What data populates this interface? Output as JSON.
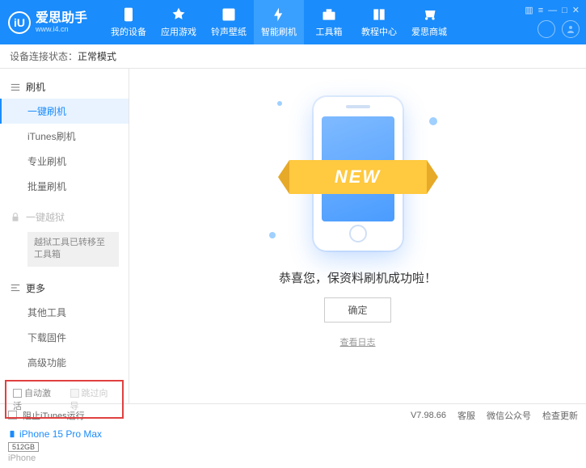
{
  "header": {
    "logo_mark": "iU",
    "app_name": "爱思助手",
    "url": "www.i4.cn",
    "nav": [
      {
        "label": "我的设备"
      },
      {
        "label": "应用游戏"
      },
      {
        "label": "铃声壁纸"
      },
      {
        "label": "智能刷机"
      },
      {
        "label": "工具箱"
      },
      {
        "label": "教程中心"
      },
      {
        "label": "爱思商城"
      }
    ]
  },
  "status": {
    "label": "设备连接状态：",
    "value": "正常模式"
  },
  "sidebar": {
    "flash": {
      "title": "刷机",
      "items": [
        "一键刷机",
        "iTunes刷机",
        "专业刷机",
        "批量刷机"
      ]
    },
    "jailbreak": {
      "title": "一键越狱",
      "note": "越狱工具已转移至工具箱"
    },
    "more": {
      "title": "更多",
      "items": [
        "其他工具",
        "下载固件",
        "高级功能"
      ]
    },
    "options": {
      "auto_activate": "自动激活",
      "skip_guide": "跳过向导"
    },
    "device": {
      "name": "iPhone 15 Pro Max",
      "capacity": "512GB",
      "type": "iPhone"
    }
  },
  "main": {
    "banner_text": "NEW",
    "success_message": "恭喜您，保资料刷机成功啦！",
    "confirm_button": "确定",
    "view_log": "查看日志"
  },
  "footer": {
    "block_itunes": "阻止iTunes运行",
    "version": "V7.98.66",
    "links": [
      "客服",
      "微信公众号",
      "检查更新"
    ]
  }
}
